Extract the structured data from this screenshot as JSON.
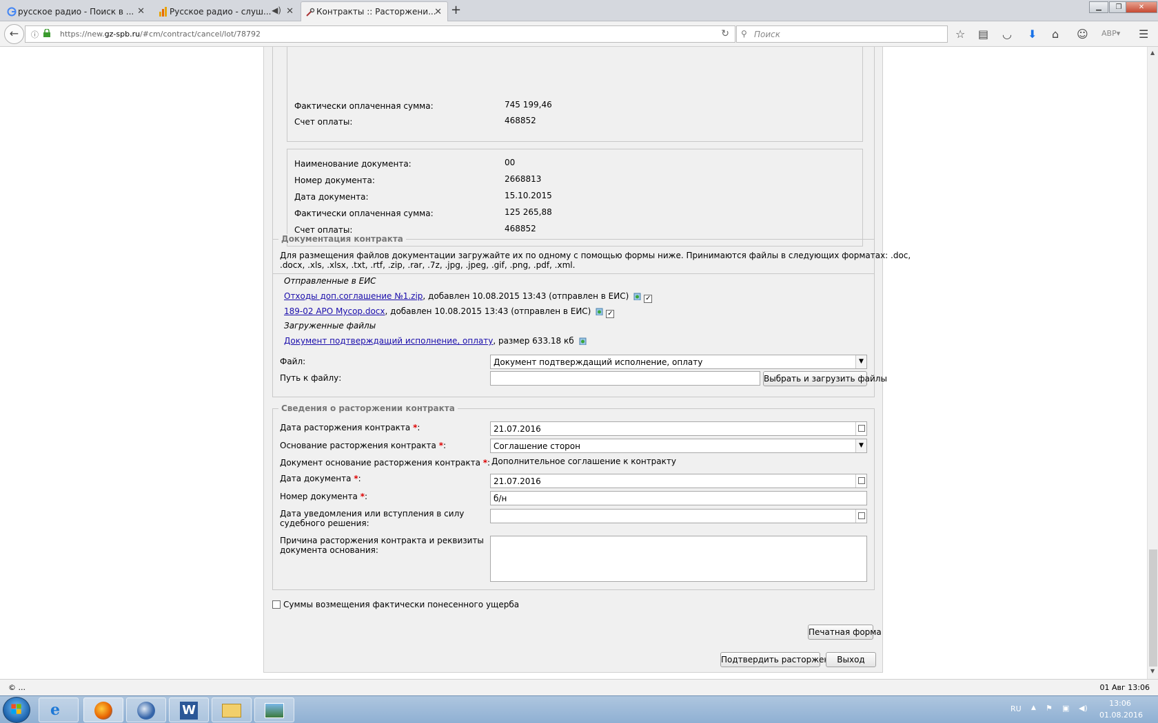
{
  "browser": {
    "tabs": [
      {
        "title": "русское радио - Поиск в ..."
      },
      {
        "title": "Русское радио - слуш..."
      },
      {
        "title": "Контракты :: Расторжени..."
      }
    ],
    "url_prefix": "https://new.",
    "url_domain": "gz-spb.ru",
    "url_path": "/#cm/contract/cancel/lot/78792",
    "search_placeholder": "Поиск"
  },
  "payments": [
    {
      "rows": [
        {
          "label": "Фактически оплаченная сумма:",
          "value": "745 199,46"
        },
        {
          "label": "Счет оплаты:",
          "value": "468852"
        }
      ]
    },
    {
      "rows": [
        {
          "label": "Наименование документа:",
          "value": "00"
        },
        {
          "label": "Номер документа:",
          "value": "2668813"
        },
        {
          "label": "Дата документа:",
          "value": "15.10.2015"
        },
        {
          "label": "Фактически оплаченная сумма:",
          "value": "125 265,88"
        },
        {
          "label": "Счет оплаты:",
          "value": "468852"
        }
      ]
    }
  ],
  "docs": {
    "legend": "Документация контракта",
    "intro_line1": "Для размещения файлов документации загружайте их по одному с помощью формы ниже. Принимаются файлы в следующих форматах: .doc,",
    "intro_line2": ".docx, .xls, .xlsx, .txt, .rtf, .zip, .rar, .7z, .jpg, .jpeg, .gif, .png, .pdf, .xml.",
    "sent_heading": "Отправленные в ЕИС",
    "sent_files": [
      {
        "name": "Отходы доп.соглашение №1.zip",
        "meta": ", добавлен 10.08.2015 13:43 (отправлен в ЕИС)"
      },
      {
        "name": "189-02 АРО Мусор.docx",
        "meta": ", добавлен 10.08.2015 13:43 (отправлен в ЕИС)"
      }
    ],
    "uploaded_heading": "Загруженные файлы",
    "uploaded_files": [
      {
        "name": "Документ подтверждащий исполнение, оплату",
        "meta": ", размер 633.18 кб"
      }
    ],
    "file_label": "Файл:",
    "file_value": "Документ подтверждащий исполнение, оплату",
    "path_label": "Путь к файлу:",
    "upload_button": "Выбрать и загрузить файлы"
  },
  "termination": {
    "legend": "Сведения о расторжении контракта",
    "date_label": "Дата расторжения контракта",
    "date_value": "21.07.2016",
    "basis_label": "Основание расторжения контракта",
    "basis_value": "Соглашение сторон",
    "doc_basis_label": "Документ основание расторжения контракта",
    "doc_basis_value": "Дополнительное соглашение к контракту",
    "doc_date_label": "Дата документа",
    "doc_date_value": "21.07.2016",
    "doc_num_label": "Номер документа",
    "doc_num_value": "б/н",
    "notice_label_1": "Дата уведомления или вступления в силу",
    "notice_label_2": "судебного решения:",
    "reason_label_1": "Причина расторжения контракта и реквизиты",
    "reason_label_2": "документа основания:",
    "required_mark": "*",
    "colon": ":"
  },
  "damages_checkbox_label": "Суммы возмещения фактически понесенного ущерба",
  "print_button": "Печатная форма",
  "confirm_button": "Подтвердить расторжение",
  "exit_button": "Выход",
  "status": {
    "left": "© ...",
    "right": "01 Авг 13:06"
  },
  "taskbar": {
    "lang": "RU",
    "time": "13:06",
    "date": "01.08.2016"
  }
}
